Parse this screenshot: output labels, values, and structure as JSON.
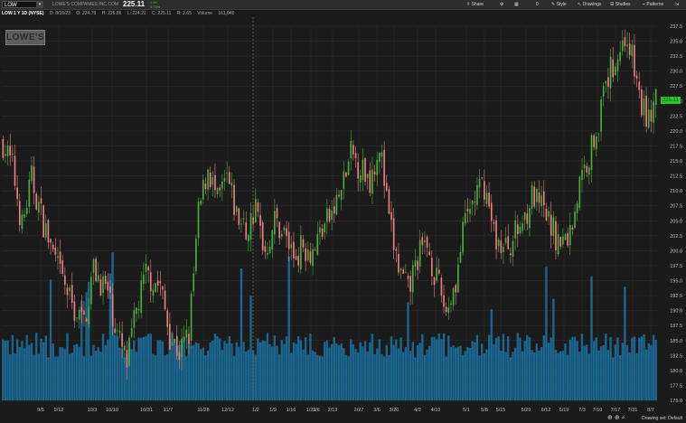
{
  "toolbar": {
    "symbol": "LOW",
    "company_name": "LOWE'S COMPANIES INC COM",
    "last_price": "225.11",
    "change_abs": "1.69",
    "change_pct": "0.75%",
    "share": "Share",
    "style": "Style",
    "drawings": "Drawings",
    "studies": "Studies",
    "patterns": "Patterns",
    "settings_value": "0"
  },
  "infobar": {
    "symbol_label": "LOW 1 Y 1D (NYSE)",
    "date": "D: 8/16/23",
    "open": "O: 224.79",
    "high": "H: 226.86",
    "low": "L: 224.21",
    "close": "C: 225.11",
    "range": "R: 2.65",
    "volume_label": "Volume",
    "volume": "161,049"
  },
  "logo_text": "LOWE'S",
  "current_price_label": "225.11",
  "bottom": {
    "drawing_set": "Drawing set: Default"
  },
  "colors": {
    "up": "#4caf3a",
    "down": "#f08080",
    "volume": "#1c6f9c",
    "grid": "#2c2c2c",
    "background": "#1b1b1b"
  },
  "chart_data": {
    "type": "candlestick",
    "title": "",
    "xlabel": "",
    "ylabel": "",
    "ylim": [
      175,
      237.5
    ],
    "yticks": [
      175,
      177.5,
      180,
      182.5,
      185,
      187.5,
      190,
      192.5,
      195,
      197.5,
      200,
      202.5,
      205,
      207.5,
      210,
      212.5,
      215,
      217.5,
      220,
      222.5,
      225,
      227.5,
      230,
      232.5,
      235,
      237.5
    ],
    "xtick_labels": [
      "9/5",
      "9/12",
      "10/3",
      "10/10",
      "10/31",
      "11/7",
      "11/28",
      "12/12",
      "1/2",
      "1/9",
      "1/16",
      "1/23",
      "2/6",
      "2/13",
      "2/27",
      "3/6",
      "3/20",
      "4/3",
      "4/10",
      "5/1",
      "5/8",
      "5/15",
      "5/29",
      "6/12",
      "6/19",
      "7/3",
      "7/10",
      "7/17",
      "7/31",
      "8/7"
    ],
    "price_path": [
      [
        0,
        218
      ],
      [
        4,
        214
      ],
      [
        8,
        204
      ],
      [
        12,
        212
      ],
      [
        16,
        206
      ],
      [
        22,
        198
      ],
      [
        26,
        194
      ],
      [
        30,
        190
      ],
      [
        34,
        188
      ],
      [
        38,
        197
      ],
      [
        44,
        193
      ],
      [
        48,
        186
      ],
      [
        52,
        181
      ],
      [
        56,
        190
      ],
      [
        60,
        196
      ],
      [
        66,
        194
      ],
      [
        70,
        186
      ],
      [
        74,
        183
      ],
      [
        78,
        186
      ],
      [
        82,
        206
      ],
      [
        86,
        214
      ],
      [
        90,
        208
      ],
      [
        94,
        212
      ],
      [
        98,
        206
      ],
      [
        102,
        203
      ],
      [
        106,
        207
      ],
      [
        110,
        200
      ],
      [
        114,
        205
      ],
      [
        118,
        203
      ],
      [
        122,
        199
      ],
      [
        126,
        201
      ],
      [
        130,
        200
      ],
      [
        134,
        204
      ],
      [
        138,
        206
      ],
      [
        142,
        210
      ],
      [
        146,
        216
      ],
      [
        150,
        214
      ],
      [
        154,
        212
      ],
      [
        158,
        218
      ],
      [
        162,
        205
      ],
      [
        166,
        197
      ],
      [
        170,
        193
      ],
      [
        174,
        199
      ],
      [
        178,
        201
      ],
      [
        182,
        195
      ],
      [
        186,
        190
      ],
      [
        190,
        195
      ],
      [
        194,
        205
      ],
      [
        198,
        209
      ],
      [
        202,
        211
      ],
      [
        206,
        203
      ],
      [
        210,
        200
      ],
      [
        214,
        202
      ],
      [
        218,
        205
      ],
      [
        222,
        209
      ],
      [
        226,
        207
      ],
      [
        230,
        204
      ],
      [
        234,
        201
      ],
      [
        238,
        203
      ],
      [
        242,
        211
      ],
      [
        246,
        216
      ],
      [
        250,
        222
      ],
      [
        254,
        229
      ],
      [
        258,
        233
      ],
      [
        262,
        236
      ],
      [
        265,
        230
      ],
      [
        268,
        224
      ],
      [
        271,
        222
      ],
      [
        274,
        225
      ]
    ],
    "period_count": 275,
    "volume_range": [
      0,
      100
    ]
  }
}
